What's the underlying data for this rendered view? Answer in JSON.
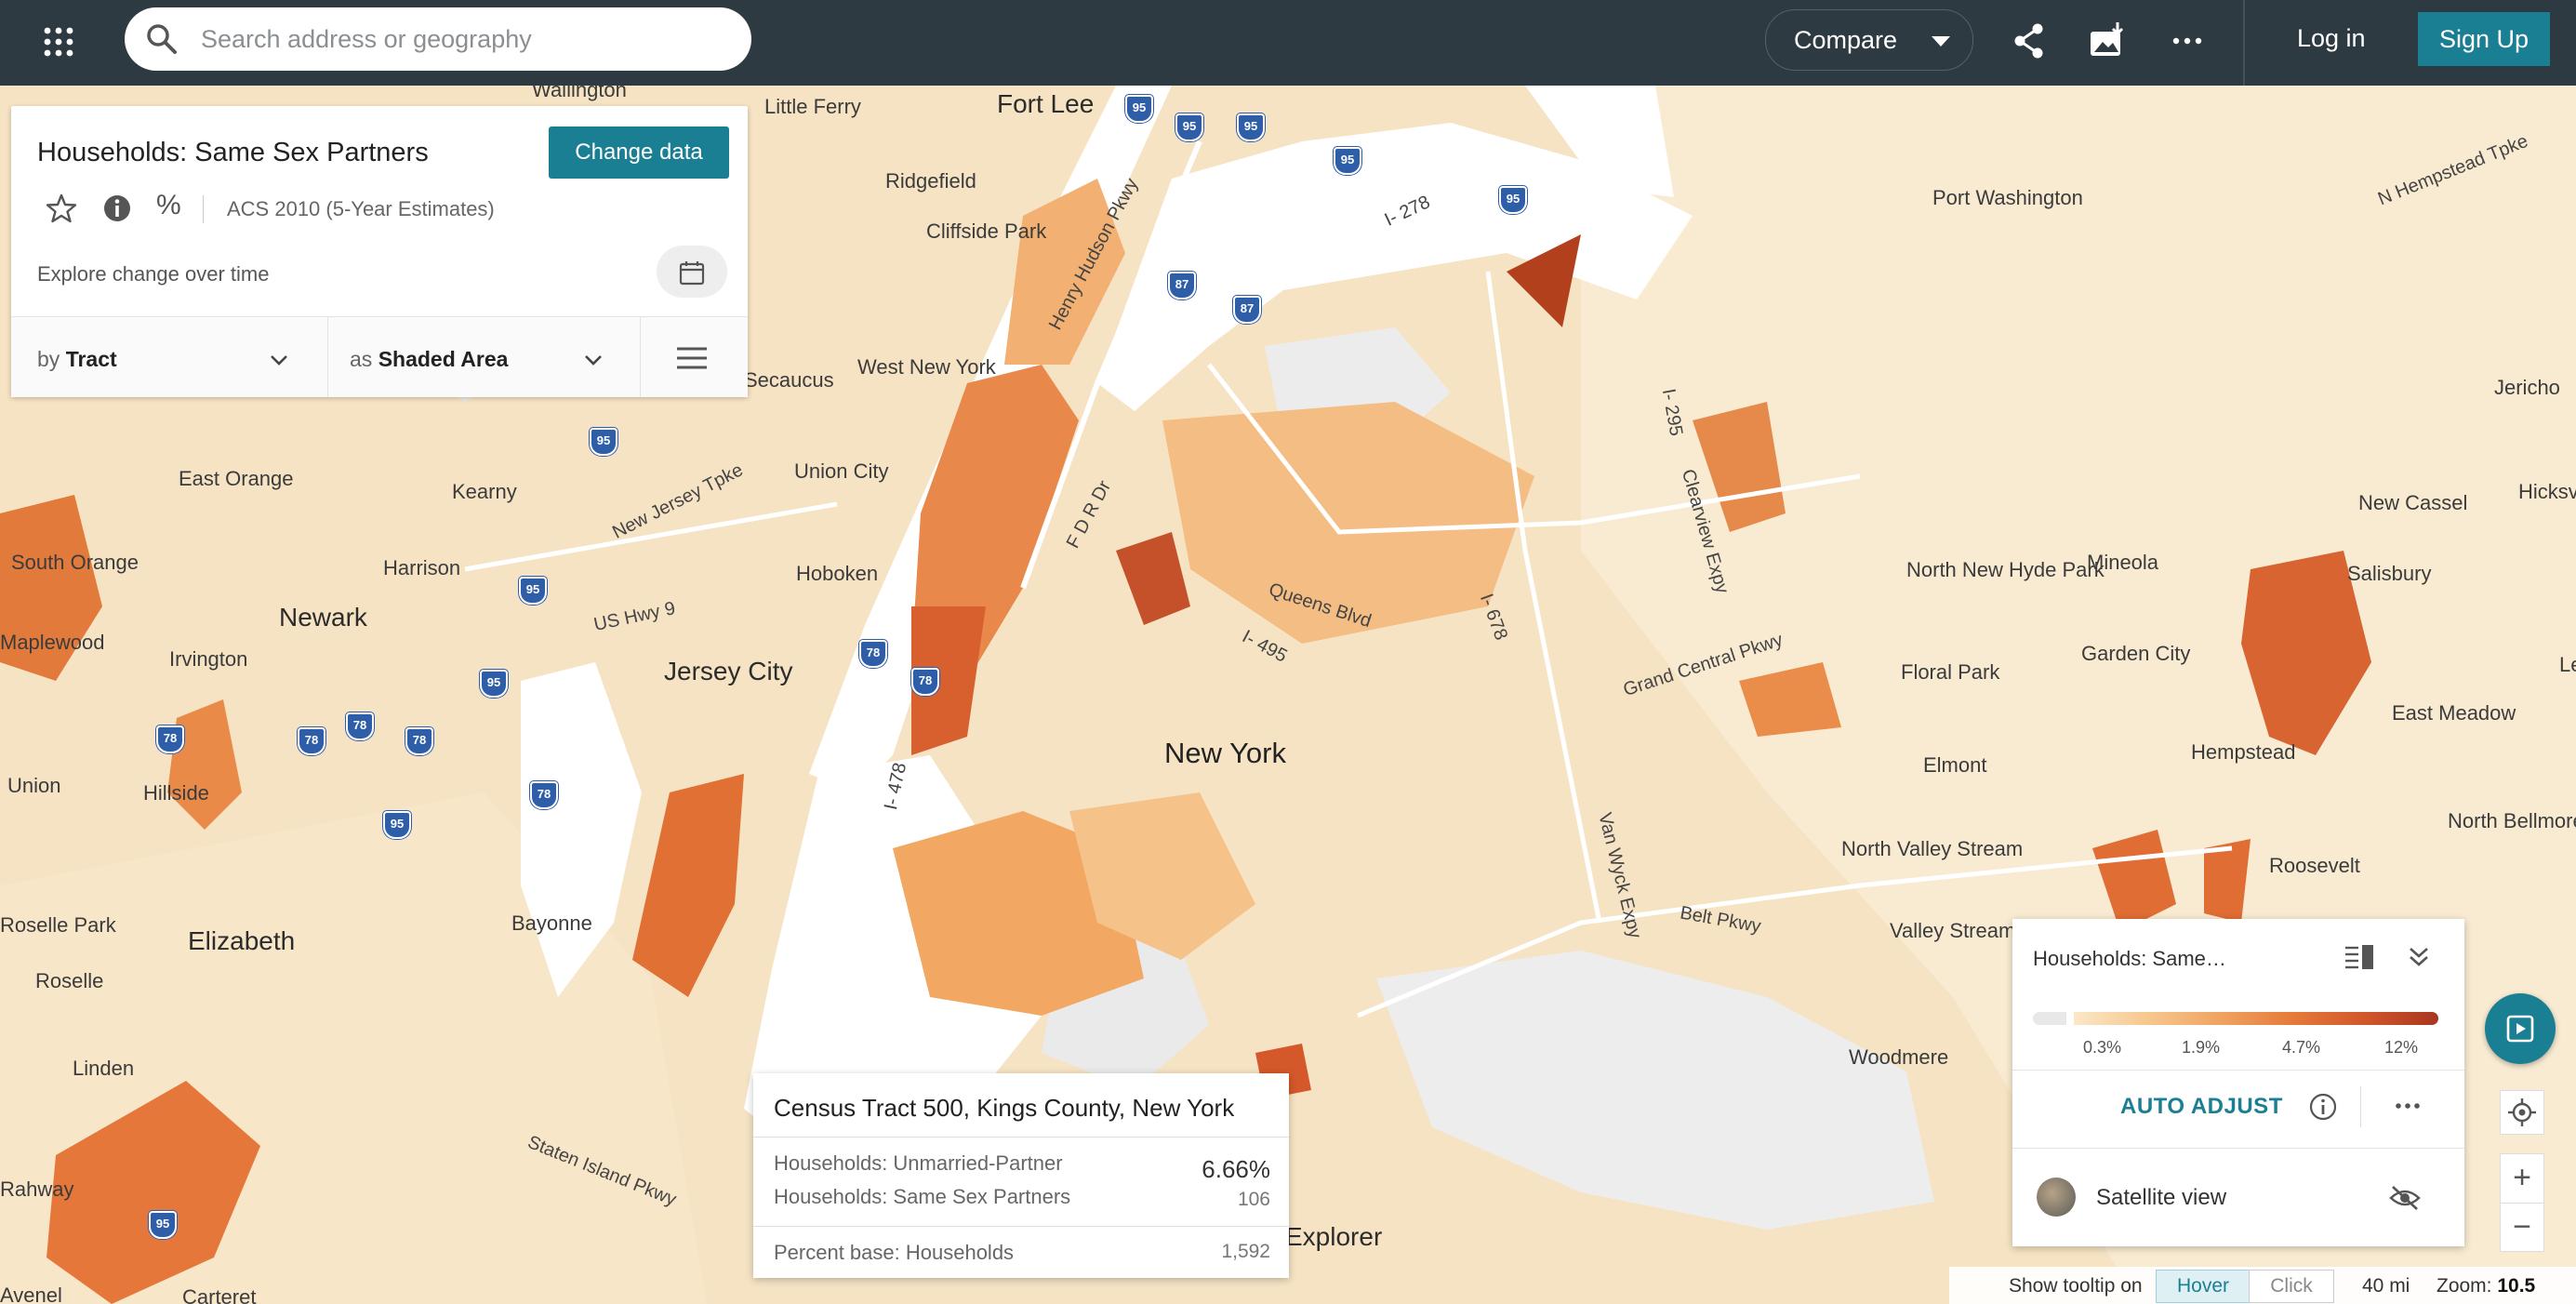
{
  "search": {
    "placeholder": "Search address or geography"
  },
  "toolbar": {
    "compare_label": "Compare",
    "login_label": "Log in",
    "signup_label": "Sign Up"
  },
  "panel": {
    "title": "Households: Same Sex Partners",
    "change_data_label": "Change data",
    "dataset": "ACS 2010 (5-Year Estimates)",
    "percent_symbol": "%",
    "explore_label": "Explore change over time",
    "by_prefix": "by",
    "by_value": "Tract",
    "as_prefix": "as",
    "as_value": "Shaded Area"
  },
  "map": {
    "places": [
      "Wallington",
      "Little Ferry",
      "Fort Lee",
      "Ridgefield",
      "Cliffside Park",
      "West New York",
      "Union City",
      "Hoboken",
      "Jersey City",
      "New York",
      "Newark",
      "Kearny",
      "Harrison",
      "East Orange",
      "South Orange",
      "Irvington",
      "Maplewood",
      "Hillside",
      "Union",
      "Elizabeth",
      "Roselle",
      "Roselle Park",
      "Bayonne",
      "Linden",
      "Carteret",
      "Port Washington",
      "Jericho",
      "New Cassel",
      "Hicksville",
      "Mineola",
      "North New Hyde Park",
      "Salisbury",
      "Garden City",
      "Floral Park",
      "East Meadow",
      "Elmont",
      "Hempstead",
      "North Bellmore",
      "North Valley Stream",
      "Roosevelt",
      "Valley Stream",
      "Woodmere",
      "Explorer",
      "Secaucus",
      "Levittown",
      "Rahway",
      "Avenel"
    ],
    "roads": [
      "Henry Hudson Pkwy",
      "F D R Dr",
      "Queens Blvd",
      "I- 495",
      "I- 278",
      "I- 678",
      "I- 295",
      "Clearview Expy",
      "Grand Central Pkwy",
      "Van Wyck Expy",
      "Belt Pkwy",
      "US Hwy 9",
      "New Jersey Tpke",
      "Staten Island Pkwy",
      "N Hempstead Tpke",
      "I- 478"
    ],
    "shields": [
      "95",
      "87",
      "78",
      "278",
      "678",
      "9"
    ]
  },
  "tooltip": {
    "title": "Census Tract 500, Kings County, New York",
    "row1_label": "Households: Unmarried-Partner",
    "row1_value": "6.66%",
    "row2_label": "Households: Same Sex Partners",
    "row2_value": "106",
    "row3_label": "Percent base: Households",
    "row3_value": "1,592"
  },
  "legend": {
    "title": "Households: Same…",
    "ticks": [
      "0.3%",
      "1.9%",
      "4.7%",
      "12%"
    ],
    "auto_adjust_label": "AUTO ADJUST",
    "satellite_label": "Satellite view",
    "colors": [
      "#fbe7c8",
      "#f7c88f",
      "#f0a361",
      "#e57a3a",
      "#d1562a",
      "#a8361f"
    ]
  },
  "statusbar": {
    "tooltip_label": "Show tooltip on",
    "hover_label": "Hover",
    "click_label": "Click",
    "scale_label": "40 mi",
    "zoom_prefix": "Zoom:",
    "zoom_value": "10.5"
  },
  "colors": {
    "accent": "#1b7f94",
    "topbar": "#2d3a41",
    "water": "#ffffff",
    "land": "#f6e3c4"
  }
}
